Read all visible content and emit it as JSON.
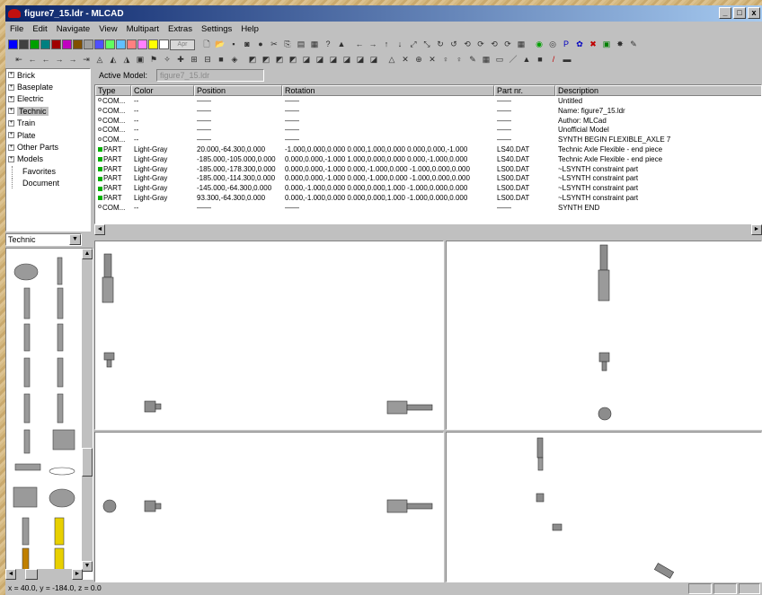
{
  "app": {
    "title": "figure7_15.ldr - MLCAD"
  },
  "window_buttons": [
    "_",
    "□",
    "x"
  ],
  "menu": [
    "File",
    "Edit",
    "Navigate",
    "View",
    "Multipart",
    "Extras",
    "Settings",
    "Help"
  ],
  "toolbar": {
    "palette_label": "Apr",
    "colors": [
      "#0000ff",
      "#404040",
      "#00a000",
      "#008080",
      "#a00000",
      "#c000c0",
      "#805000",
      "#a0a0a0",
      "#5050ff",
      "#60ff60",
      "#60c0ff",
      "#ff8080",
      "#ff80ff",
      "#ffff00",
      "#ffffff"
    ],
    "row1_icons": [
      {
        "name": "new-file-icon",
        "glyph": "🗋"
      },
      {
        "name": "open-file-icon",
        "glyph": "📂"
      },
      {
        "name": "save-icon",
        "glyph": "▪"
      },
      {
        "name": "camera-icon",
        "glyph": "◙"
      },
      {
        "name": "brick-icon",
        "glyph": "●"
      },
      {
        "name": "cut-icon",
        "glyph": "✂"
      },
      {
        "name": "copy-icon",
        "glyph": "⎘"
      },
      {
        "name": "paste-icon",
        "glyph": "▤"
      },
      {
        "name": "print-icon",
        "glyph": "▦"
      },
      {
        "name": "help-icon",
        "glyph": "?"
      },
      {
        "name": "context-help-icon",
        "glyph": "▲"
      }
    ],
    "row1_move": [
      {
        "name": "move-left-icon",
        "glyph": "←"
      },
      {
        "name": "move-right-icon",
        "glyph": "→"
      },
      {
        "name": "move-up-icon",
        "glyph": "↑"
      },
      {
        "name": "move-down-icon",
        "glyph": "↓"
      },
      {
        "name": "move-diag-icon",
        "glyph": "⤢"
      },
      {
        "name": "move-diag2-icon",
        "glyph": "⤡"
      },
      {
        "name": "rotate-x-icon",
        "glyph": "↻"
      },
      {
        "name": "rotate-y-icon",
        "glyph": "↺"
      },
      {
        "name": "rotate-z-icon",
        "glyph": "⟲"
      },
      {
        "name": "rotate-x2-icon",
        "glyph": "⟳"
      },
      {
        "name": "rotate-y2-icon",
        "glyph": "⟲"
      },
      {
        "name": "rotate-z2-icon",
        "glyph": "⟳"
      },
      {
        "name": "grid-icon",
        "glyph": "▦"
      }
    ],
    "row1_right": [
      {
        "name": "minifig-icon",
        "glyph": "◉",
        "color": "#00a000"
      },
      {
        "name": "model-icon",
        "glyph": "◎"
      },
      {
        "name": "p-icon",
        "glyph": "P",
        "color": "#0000c0"
      },
      {
        "name": "gear-icon",
        "glyph": "✿",
        "color": "#0000c0"
      },
      {
        "name": "delete-icon",
        "glyph": "✖",
        "color": "#c00000"
      },
      {
        "name": "image-icon",
        "glyph": "▣",
        "color": "#008000"
      },
      {
        "name": "render-icon",
        "glyph": "✸"
      },
      {
        "name": "settings-icon",
        "glyph": "✎"
      }
    ],
    "row2_icons": [
      {
        "name": "nav-first-icon",
        "glyph": "⇤"
      },
      {
        "name": "nav-prev2-icon",
        "glyph": "←"
      },
      {
        "name": "nav-prev-icon",
        "glyph": "←"
      },
      {
        "name": "nav-next-icon",
        "glyph": "→"
      },
      {
        "name": "nav-next2-icon",
        "glyph": "→"
      },
      {
        "name": "nav-last-icon",
        "glyph": "⇥"
      },
      {
        "name": "step-icon",
        "glyph": "◬"
      },
      {
        "name": "hide-icon",
        "glyph": "◭"
      },
      {
        "name": "unhide-icon",
        "glyph": "◮"
      },
      {
        "name": "select-icon",
        "glyph": "▣"
      },
      {
        "name": "color-icon",
        "glyph": "⚑"
      },
      {
        "name": "shape-icon",
        "glyph": "✧"
      },
      {
        "name": "insert-icon",
        "glyph": "✚"
      },
      {
        "name": "table-icon",
        "glyph": "⊞"
      },
      {
        "name": "grid2-icon",
        "glyph": "⊟"
      },
      {
        "name": "block-icon",
        "glyph": "■"
      },
      {
        "name": "wireframe-icon",
        "glyph": "◈"
      }
    ],
    "row2_views": [
      {
        "name": "view-1-icon",
        "glyph": "◩"
      },
      {
        "name": "view-2-icon",
        "glyph": "◩"
      },
      {
        "name": "view-3-icon",
        "glyph": "◩"
      },
      {
        "name": "view-4-icon",
        "glyph": "◩"
      },
      {
        "name": "view-5-icon",
        "glyph": "◪"
      },
      {
        "name": "view-6-icon",
        "glyph": "◪"
      },
      {
        "name": "view-7-icon",
        "glyph": "◪"
      },
      {
        "name": "view-8-icon",
        "glyph": "◪"
      },
      {
        "name": "view-9-icon",
        "glyph": "◪"
      },
      {
        "name": "view-10-icon",
        "glyph": "◪"
      }
    ],
    "row2_right": [
      {
        "name": "tri-icon",
        "glyph": "△"
      },
      {
        "name": "cross-icon",
        "glyph": "✕"
      },
      {
        "name": "circle-x-icon",
        "glyph": "⊕"
      },
      {
        "name": "cross2-icon",
        "glyph": "✕"
      },
      {
        "name": "bulb-icon",
        "glyph": "♀"
      },
      {
        "name": "bulb2-icon",
        "glyph": "♀"
      },
      {
        "name": "pencil-icon",
        "glyph": "✎"
      },
      {
        "name": "grid3-icon",
        "glyph": "▦"
      },
      {
        "name": "rect-icon",
        "glyph": "▭"
      },
      {
        "name": "line-icon",
        "glyph": "／"
      },
      {
        "name": "triangle-icon",
        "glyph": "▲"
      },
      {
        "name": "square-icon",
        "glyph": "■"
      },
      {
        "name": "line-color-icon",
        "glyph": "/",
        "color": "#c00000"
      },
      {
        "name": "bar-icon",
        "glyph": "▬"
      }
    ]
  },
  "tree": [
    {
      "label": "Brick",
      "expandable": true
    },
    {
      "label": "Baseplate",
      "expandable": true
    },
    {
      "label": "Electric",
      "expandable": true
    },
    {
      "label": "Technic",
      "expandable": true,
      "selected": true
    },
    {
      "label": "Train",
      "expandable": true
    },
    {
      "label": "Plate",
      "expandable": true
    },
    {
      "label": "Other Parts",
      "expandable": true
    },
    {
      "label": "Models",
      "expandable": true
    },
    {
      "label": "Favorites",
      "expandable": false
    },
    {
      "label": "Document",
      "expandable": false
    }
  ],
  "category_select": {
    "value": "Technic"
  },
  "active_model": {
    "label": "Active Model:",
    "value": "figure7_15.ldr"
  },
  "grid": {
    "columns": [
      "Type",
      "Color",
      "Position",
      "Rotation",
      "Part nr.",
      "Description"
    ],
    "rows": [
      {
        "kind": "com",
        "type": "COM...",
        "color": "--",
        "position": "——",
        "rotation": "——",
        "part": "——",
        "desc": "Untitled"
      },
      {
        "kind": "com",
        "type": "COM...",
        "color": "--",
        "position": "——",
        "rotation": "——",
        "part": "——",
        "desc": "Name: figure7_15.ldr"
      },
      {
        "kind": "com",
        "type": "COM...",
        "color": "--",
        "position": "——",
        "rotation": "——",
        "part": "——",
        "desc": "Author: MLCad"
      },
      {
        "kind": "com",
        "type": "COM...",
        "color": "--",
        "position": "——",
        "rotation": "——",
        "part": "——",
        "desc": "Unofficial Model"
      },
      {
        "kind": "com",
        "type": "COM...",
        "color": "--",
        "position": "——",
        "rotation": "——",
        "part": "——",
        "desc": "SYNTH BEGIN FLEXIBLE_AXLE 7"
      },
      {
        "kind": "part",
        "type": "PART",
        "color": "Light-Gray",
        "position": "20.000,-64.300,0.000",
        "rotation": "-1.000,0.000,0.000 0.000,1.000,0.000 0.000,0.000,-1.000",
        "part": "LS40.DAT",
        "desc": "Technic Axle Flexible - end piece"
      },
      {
        "kind": "part",
        "type": "PART",
        "color": "Light-Gray",
        "position": "-185.000,-105.000,0.000",
        "rotation": "0.000,0.000,-1.000 1.000,0.000,0.000 0.000,-1.000,0.000",
        "part": "LS40.DAT",
        "desc": "Technic Axle Flexible - end piece"
      },
      {
        "kind": "part",
        "type": "PART",
        "color": "Light-Gray",
        "position": "-185.000,-178.300,0.000",
        "rotation": "0.000,0.000,-1.000 0.000,-1.000,0.000 -1.000,0.000,0.000",
        "part": "LS00.DAT",
        "desc": "~LSYNTH constraint part"
      },
      {
        "kind": "part",
        "type": "PART",
        "color": "Light-Gray",
        "position": "-185.000,-114.300,0.000",
        "rotation": "0.000,0.000,-1.000 0.000,-1.000,0.000 -1.000,0.000,0.000",
        "part": "LS00.DAT",
        "desc": "~LSYNTH constraint part"
      },
      {
        "kind": "part",
        "type": "PART",
        "color": "Light-Gray",
        "position": "-145.000,-64.300,0.000",
        "rotation": "0.000,-1.000,0.000 0.000,0.000,1.000 -1.000,0.000,0.000",
        "part": "LS00.DAT",
        "desc": "~LSYNTH constraint part"
      },
      {
        "kind": "part",
        "type": "PART",
        "color": "Light-Gray",
        "position": "93.300,-64.300,0.000",
        "rotation": "0.000,-1.000,0.000 0.000,0.000,1.000 -1.000,0.000,0.000",
        "part": "LS00.DAT",
        "desc": "~LSYNTH constraint part"
      },
      {
        "kind": "com",
        "type": "COM...",
        "color": "--",
        "position": "——",
        "rotation": "——",
        "part": "——",
        "desc": "SYNTH END"
      }
    ]
  },
  "status": {
    "coords": "x = 40.0, y = -184.0, z = 0.0"
  }
}
